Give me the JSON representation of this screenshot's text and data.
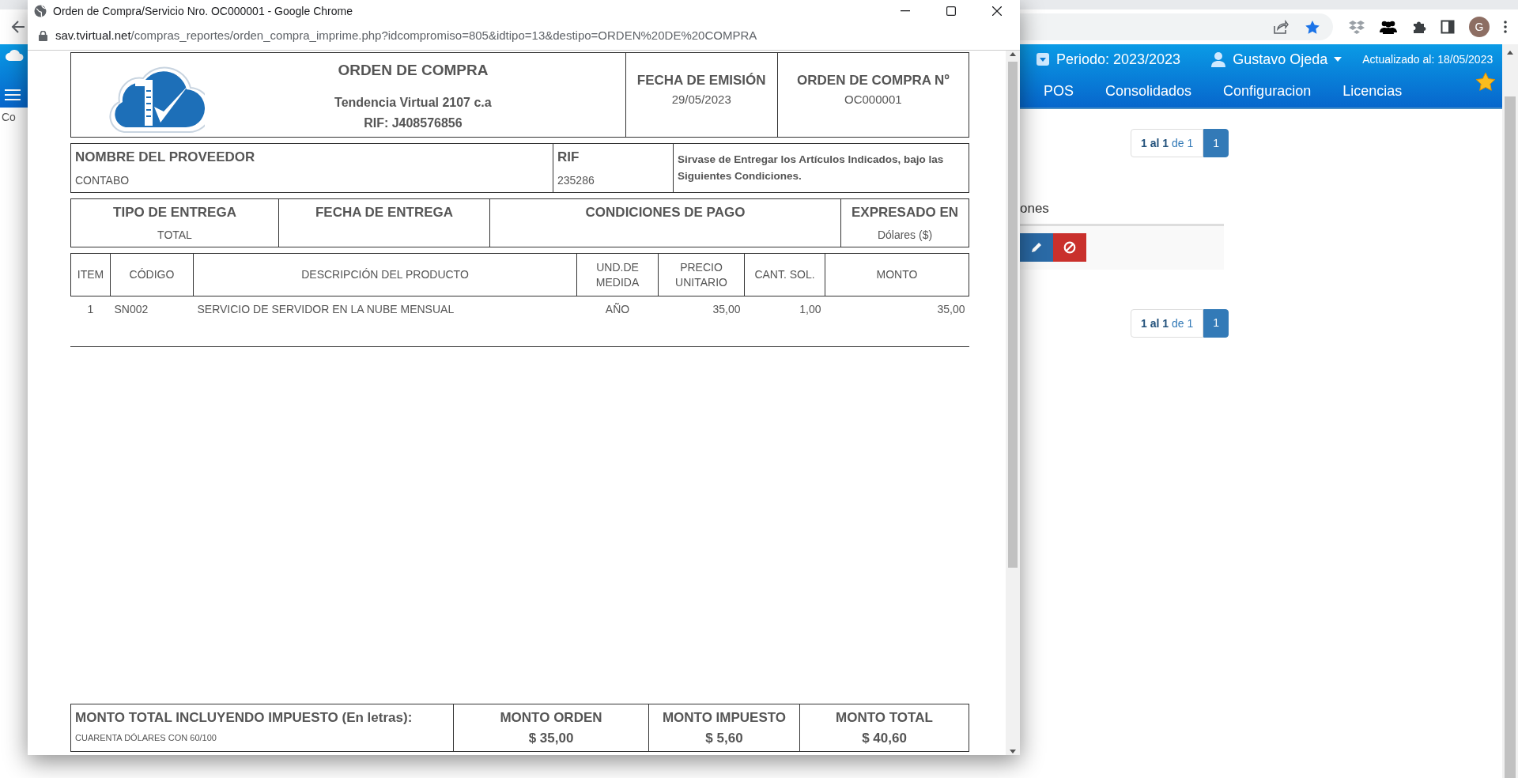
{
  "browser": {
    "avatar_letter": "G"
  },
  "app": {
    "period": "Periodo: 2023/2023",
    "user": "Gustavo Ojeda",
    "updated": "Actualizado al: 18/05/2023",
    "menu": [
      "POS",
      "Consolidados",
      "Configuracion",
      "Licencias"
    ],
    "left_fragment": "Co",
    "section_fragment": "ones",
    "paginations": [
      {
        "summary": "**1 al 1** de 1",
        "pages": [
          {
            "label": "1",
            "selected": true
          }
        ]
      },
      {
        "summary": "**1 al 1** de 1",
        "pages": [
          {
            "label": "1",
            "selected": true
          }
        ]
      }
    ]
  },
  "popup": {
    "title": "Orden de Compra/Servicio Nro. OC000001 - Google Chrome",
    "url_host": "sav.tvirtual.net",
    "url_path": "/compras_reportes/orden_compra_imprime.php?idcompromiso=805&idtipo=13&destipo=ORDEN%20DE%20COMPRA",
    "document": {
      "title": "ORDEN DE COMPRA",
      "company": "Tendencia Virtual 2107 c.a",
      "rif": "RIF: J408576856",
      "header_fields": [
        {
          "label": "FECHA DE EMISIÓN",
          "value": "29/05/2023"
        },
        {
          "label": "ORDEN DE COMPRA Nº",
          "value": "OC000001"
        }
      ],
      "supplier": {
        "name_label": "NOMBRE DEL PROVEEDOR",
        "name": "CONTABO",
        "rif_label": "RIF",
        "rif": "235286",
        "note": "Sirvase de Entregar los Artículos Indicados, bajo las Siguientes Condiciones."
      },
      "delivery": [
        {
          "label": "TIPO DE ENTREGA",
          "value": "TOTAL"
        },
        {
          "label": "FECHA DE ENTREGA"
        },
        {
          "label": "CONDICIONES DE PAGO"
        },
        {
          "label": "EXPRESADO EN",
          "value": "Dólares ($)"
        }
      ],
      "items": {
        "columns": [
          "ITEM",
          "CÓDIGO",
          "DESCRIPCIÓN DEL PRODUCTO",
          "UND.DE MEDIDA",
          "PRECIO UNITARIO",
          "CANT. SOL.",
          "MONTO"
        ],
        "rows": [
          [
            "1",
            "SN002",
            "SERVICIO DE SERVIDOR EN LA NUBE MENSUAL",
            "AÑO",
            "35,00",
            "1,00",
            "35,00"
          ]
        ]
      },
      "totals": {
        "words_label": "MONTO TOTAL INCLUYENDO IMPUESTO (En letras):",
        "words": "CUARENTA DÓLARES CON 60/100",
        "amounts": [
          {
            "label": "MONTO ORDEN",
            "value": "$ 35,00"
          },
          {
            "label": "MONTO IMPUESTO",
            "value": "$ 5,60"
          },
          {
            "label": "MONTO TOTAL",
            "value": "$ 40,60"
          }
        ]
      }
    }
  }
}
